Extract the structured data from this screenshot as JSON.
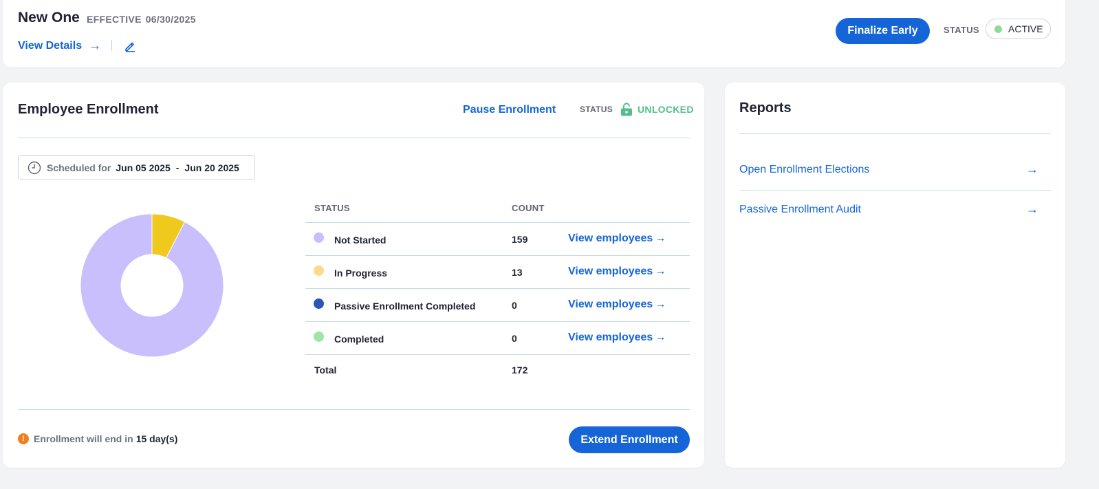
{
  "plan": {
    "title": "New One",
    "effective_label": "EFFECTIVE",
    "effective_date": "06/30/2025",
    "view_details_label": "View Details",
    "arrow": "→",
    "finalize_label": "Finalize Early",
    "status_label": "STATUS",
    "status_value": "ACTIVE",
    "status_color": "#8fdc98"
  },
  "enrollment": {
    "title": "Employee Enrollment",
    "pause_label": "Pause Enrollment",
    "status_label": "STATUS",
    "lock_status": "UNLOCKED",
    "schedule": {
      "label": "Scheduled for",
      "start": "Jun 05 2025",
      "separator": "-",
      "end": "Jun 20 2025"
    },
    "table": {
      "headers": {
        "status": "STATUS",
        "count": "COUNT"
      },
      "rows": [
        {
          "status": "Not Started",
          "count": "159",
          "color": "#c9bffc",
          "link": "View employees"
        },
        {
          "status": "In Progress",
          "count": "13",
          "color": "#fcd98c",
          "link": "View employees"
        },
        {
          "status": "Passive Enrollment Completed",
          "count": "0",
          "color": "#2857b8",
          "link": "View employees"
        },
        {
          "status": "Completed",
          "count": "0",
          "color": "#9ee6a4",
          "link": "View employees"
        }
      ],
      "total_label": "Total",
      "total_count": "172"
    },
    "chart_data": {
      "type": "pie",
      "categories": [
        "Not Started",
        "In Progress",
        "Passive Enrollment Completed",
        "Completed"
      ],
      "values": [
        159,
        13,
        0,
        0
      ],
      "colors": [
        "#c9bffc",
        "#efc91d",
        "#2857b8",
        "#9ee6a4"
      ]
    },
    "end_note_text": "Enrollment will end in",
    "end_note_days": "15 day(s)",
    "warn_glyph": "!",
    "extend_label": "Extend Enrollment"
  },
  "reports": {
    "title": "Reports",
    "items": [
      {
        "label": "Open Enrollment Elections",
        "arrow": "→"
      },
      {
        "label": "Passive Enrollment Audit",
        "arrow": "→"
      }
    ]
  }
}
